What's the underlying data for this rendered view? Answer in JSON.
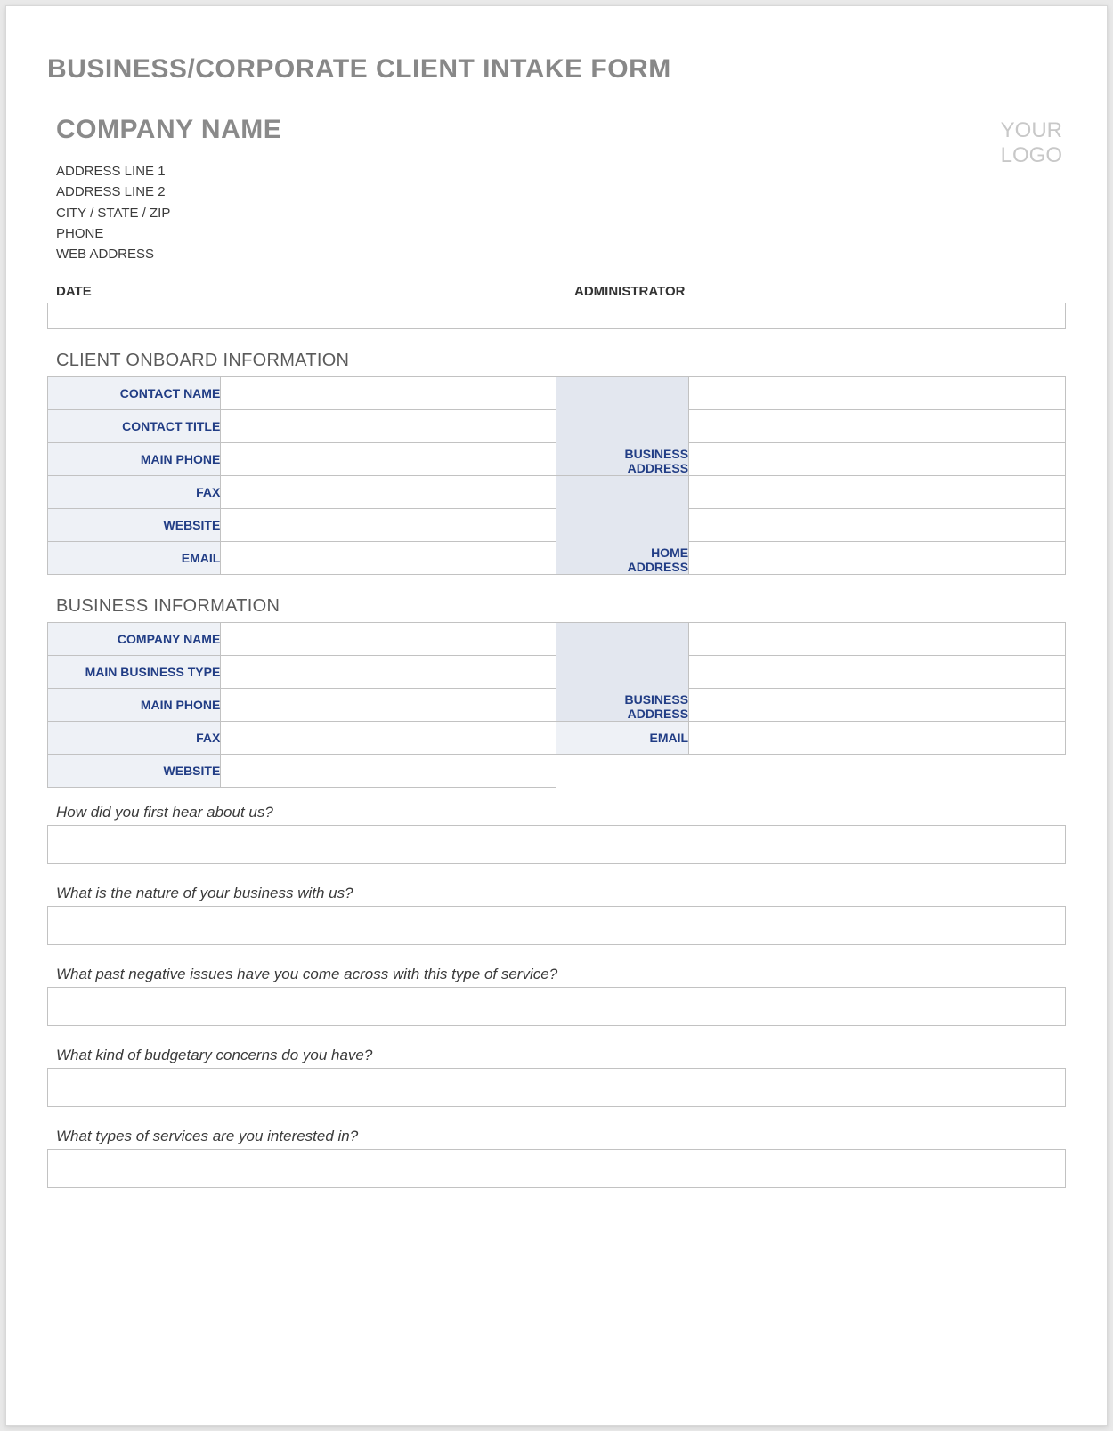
{
  "title": "BUSINESS/CORPORATE CLIENT INTAKE FORM",
  "header": {
    "company_name": "COMPANY NAME",
    "logo_line1": "YOUR",
    "logo_line2": "LOGO",
    "addr": [
      "ADDRESS LINE 1",
      "ADDRESS LINE 2",
      "CITY / STATE / ZIP",
      "PHONE",
      "WEB ADDRESS"
    ]
  },
  "da": {
    "date_label": "DATE",
    "admin_label": "ADMINISTRATOR",
    "date_value": "",
    "admin_value": ""
  },
  "sections": {
    "onboard_title": "CLIENT ONBOARD INFORMATION",
    "business_title": "BUSINESS INFORMATION"
  },
  "onboard": {
    "left": [
      "CONTACT NAME",
      "CONTACT TITLE",
      "MAIN PHONE",
      "FAX",
      "WEBSITE",
      "EMAIL"
    ],
    "addr1": "BUSINESS\nADDRESS",
    "addr2": "HOME\nADDRESS"
  },
  "business": {
    "left": [
      "COMPANY NAME",
      "MAIN BUSINESS TYPE",
      "MAIN PHONE",
      "FAX",
      "WEBSITE"
    ],
    "addr": "BUSINESS\nADDRESS",
    "email": "EMAIL"
  },
  "questions": [
    "How did you first hear about us?",
    "What is the nature of your business with us?",
    "What past negative issues have you come across with this type of service?",
    "What kind of budgetary concerns do you have?",
    "What types of services are you interested in?"
  ]
}
